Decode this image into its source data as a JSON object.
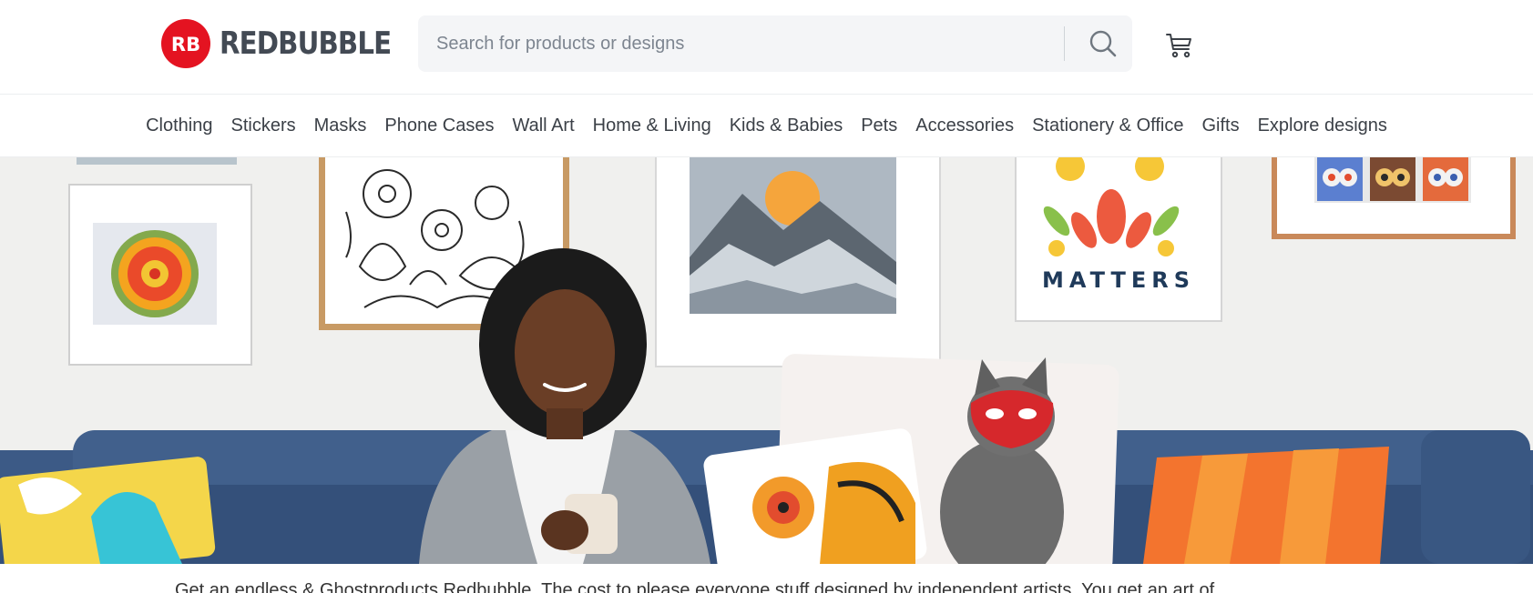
{
  "brand": {
    "logo_mark": "RB",
    "name": "REDBUBBLE",
    "colors": {
      "red": "#e41321",
      "dark": "#434a54"
    }
  },
  "search": {
    "placeholder": "Search for products or designs",
    "value": "",
    "icon": "search-icon"
  },
  "cart": {
    "icon": "cart-icon"
  },
  "nav": {
    "items": [
      {
        "label": "Clothing"
      },
      {
        "label": "Stickers"
      },
      {
        "label": "Masks"
      },
      {
        "label": "Phone Cases"
      },
      {
        "label": "Wall Art"
      },
      {
        "label": "Home & Living"
      },
      {
        "label": "Kids & Babies"
      },
      {
        "label": "Pets"
      },
      {
        "label": "Accessories"
      },
      {
        "label": "Stationery & Office"
      },
      {
        "label": "Gifts"
      },
      {
        "label": "Explore designs"
      }
    ]
  },
  "hero": {
    "poster_text": "MATTERS"
  },
  "intro": {
    "text": "Get an endless & Ghostproducts Redbubble. The cost to please everyone stuff designed by independent artists. You get an art of…"
  }
}
